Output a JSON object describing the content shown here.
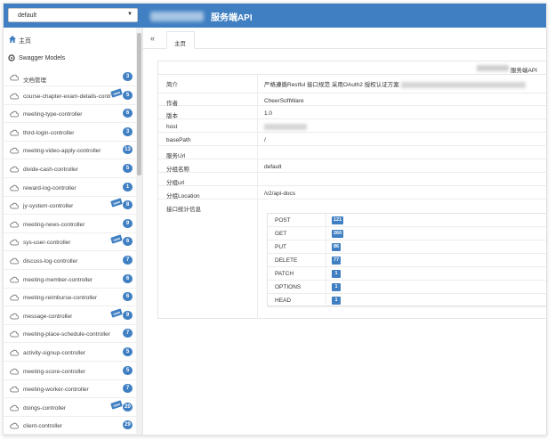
{
  "header": {
    "group_select_value": "default",
    "app_title": "服务端API"
  },
  "sidebar": {
    "home_label": "主页",
    "swagger_models_label": "Swagger Models",
    "items": [
      {
        "label": "文档管理",
        "count": "3",
        "new": false
      },
      {
        "label": "course-chapter-exam-details-contr",
        "count": "5",
        "new": true
      },
      {
        "label": "meeting-type-controller",
        "count": "6",
        "new": false
      },
      {
        "label": "third-login-controller",
        "count": "3",
        "new": false
      },
      {
        "label": "meeting-video-apply-controller",
        "count": "13",
        "new": false
      },
      {
        "label": "divide-cash-controller",
        "count": "5",
        "new": false
      },
      {
        "label": "reward-log-controller",
        "count": "1",
        "new": false
      },
      {
        "label": "jy-system-controller",
        "count": "8",
        "new": true
      },
      {
        "label": "meeting-news-controller",
        "count": "9",
        "new": false
      },
      {
        "label": "sys-user-controller",
        "count": "6",
        "new": true
      },
      {
        "label": "discuss-log-controller",
        "count": "7",
        "new": false
      },
      {
        "label": "meeting-member-controller",
        "count": "6",
        "new": false
      },
      {
        "label": "meeting-reimburse-controller",
        "count": "6",
        "new": false
      },
      {
        "label": "message-controller",
        "count": "9",
        "new": true
      },
      {
        "label": "meeting-place-schedule-controller",
        "count": "7",
        "new": false
      },
      {
        "label": "activity-signup-controller",
        "count": "5",
        "new": false
      },
      {
        "label": "meeting-score-controller",
        "count": "5",
        "new": false
      },
      {
        "label": "meeting-worker-controller",
        "count": "7",
        "new": false
      },
      {
        "label": "doings-controller",
        "count": "20",
        "new": true
      },
      {
        "label": "client-controller",
        "count": "29",
        "new": false
      }
    ],
    "new_tag_label": "new"
  },
  "tabs": {
    "collapse_glyph": "«",
    "active_tab": "主页"
  },
  "info": {
    "header_suffix": "服务端API",
    "rows": [
      {
        "key": "简介",
        "value": "严格遵循Restful 接口规范 采用OAuth2 授权认证方案"
      },
      {
        "key": "作者",
        "value": "CheerSoftWare"
      },
      {
        "key": "版本",
        "value": "1.0"
      },
      {
        "key": "host",
        "value": ""
      },
      {
        "key": "basePath",
        "value": "/"
      },
      {
        "key": "服务Url",
        "value": ""
      },
      {
        "key": "分组名称",
        "value": "default"
      },
      {
        "key": "分组url",
        "value": ""
      },
      {
        "key": "分组Location",
        "value": "/v2/api-docs"
      },
      {
        "key": "接口统计信息",
        "value": ""
      }
    ]
  },
  "stats": [
    {
      "method": "POST",
      "count": "121"
    },
    {
      "method": "GET",
      "count": "260"
    },
    {
      "method": "PUT",
      "count": "86"
    },
    {
      "method": "DELETE",
      "count": "77"
    },
    {
      "method": "PATCH",
      "count": "1"
    },
    {
      "method": "OPTIONS",
      "count": "1"
    },
    {
      "method": "HEAD",
      "count": "1"
    }
  ],
  "colors": {
    "primary": "#3f7fc2",
    "badge": "#3f7fc2"
  },
  "icons": {
    "home": "home-icon",
    "swagger_models": "gear-icon",
    "controller": "cloud-icon",
    "collapse": "double-chevron-left-icon"
  }
}
